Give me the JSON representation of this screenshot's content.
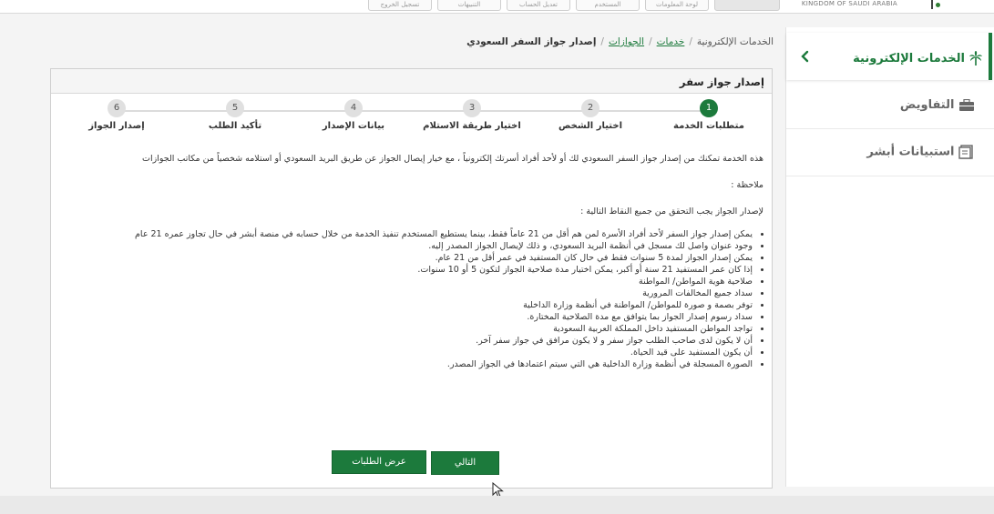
{
  "header": {
    "kingdom_text": "KINGDOM OF SAUDI ARABIA",
    "buttons": [
      "تسجيل الخروج",
      "التنبيهات",
      "تعديل الحساب",
      "المستخدم",
      "لوحة المعلومات"
    ]
  },
  "sidebar": {
    "title": "الخدمات الإلكترونية",
    "items": [
      {
        "label": "التفاويض",
        "icon": "briefcase-icon"
      },
      {
        "label": "استبيانات أبشر",
        "icon": "survey-icon"
      }
    ]
  },
  "breadcrumb": {
    "items": [
      "الخدمات الإلكترونية",
      "خدمات",
      "الجوازات",
      "إصدار جواز السفر السعودي"
    ]
  },
  "panel": {
    "title": "إصدار جواز سفر"
  },
  "steps": [
    {
      "num": "1",
      "label": "متطلبات الخدمة",
      "active": true
    },
    {
      "num": "2",
      "label": "اختيار الشخص",
      "active": false
    },
    {
      "num": "3",
      "label": "اختيار طريقة الاستلام",
      "active": false
    },
    {
      "num": "4",
      "label": "بيانات الإصدار",
      "active": false
    },
    {
      "num": "5",
      "label": "تأكيد الطلب",
      "active": false
    },
    {
      "num": "6",
      "label": "إصدار الجواز",
      "active": false
    }
  ],
  "content": {
    "intro": "هذه الخدمة تمكنك من إصدار جواز السفر السعودي لك أو لأحد أفراد أسرتك إلكترونياً ، مع خيار إيصال الجواز عن طريق البريد السعودي أو استلامه شخصياً من مكاتب الجوازات",
    "note_label": "ملاحظة :",
    "requirements_label": "لإصدار الجواز يجب التحقق من جميع النقاط التالية :",
    "bullets": [
      "يمكن إصدار جواز السفر لأحد أفراد الأسرة لمن هم أقل من 21 عاماً فقط، بينما يستطيع المستخدم تنفيذ الخدمة من خلال حسابه في منصة أبشر في حال تجاوز عمره 21 عام",
      "وجود عنوان واصل لك مسجل في أنظمة البريد السعودي، و ذلك لإيصال الجواز المصدر إليه.",
      "يمكن إصدار الجواز لمدة 5 سنوات فقط في حال كان المستفيد في عمر أقل من 21 عام.",
      "إذا كان عمر المستفيد 21 سنة أو أكبر، يمكن اختيار مدة صلاحية الجواز لتكون 5 أو 10 سنوات.",
      "صلاحية هوية المواطن/ المواطنة",
      "سداد جميع المخالفات المرورية",
      "توفر بصمة و صورة للمواطن/ المواطنة في أنظمة وزارة الداخلية",
      "سداد رسوم إصدار الجواز بما يتوافق مع مدة الصلاحية المختارة.",
      "تواجد المواطن المستفيد داخل المملكة العربية السعودية",
      "أن لا يكون لدى صاحب الطلب جواز سفر و لا يكون مرافق في جواز سفر آخر.",
      "أن يكون المستفيد على قيد الحياة.",
      "الصورة المسجلة في أنظمة وزارة الداخلية هي التي سيتم اعتمادها في الجواز المصدر."
    ]
  },
  "buttons": {
    "next": "التالي",
    "view_requests": "عرض الطلبات"
  },
  "colors": {
    "accent": "#1c7a3c",
    "step_inactive": "#e0e0e0"
  }
}
